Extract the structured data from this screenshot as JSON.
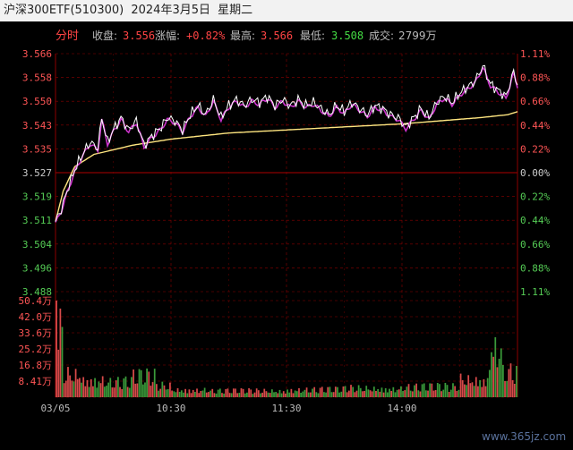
{
  "header": {
    "title": "沪深300ETF(510300)",
    "date": "2024年3月5日",
    "weekday": "星期二"
  },
  "chart_header": {
    "mode": "分时",
    "close_label": "收盘:",
    "close_value": "3.556",
    "change_label": "涨幅:",
    "change_value": "+0.82%",
    "high_label": "最高:",
    "high_value": "3.566",
    "low_label": "最低:",
    "low_value": "3.508",
    "volume_label": "成交:",
    "volume_value": "2799万"
  },
  "watermark": "www.365jz.com",
  "colors": {
    "background": "#000000",
    "grid": "#8b0000",
    "price_line": "#ffffff",
    "second_line": "#cc33cc",
    "avg_line": "#ffe680",
    "up": "#ff5555",
    "down": "#55cc55"
  },
  "chart_data": {
    "type": "line",
    "price_axis": {
      "range": [
        3.488,
        3.566
      ],
      "ticks": [
        "3.566",
        "3.558",
        "3.550",
        "3.543",
        "3.535",
        "3.527",
        "3.519",
        "3.511",
        "3.504",
        "3.496",
        "3.488"
      ],
      "reference": 3.527
    },
    "pct_axis": {
      "ticks": [
        "1.11%",
        "0.88%",
        "0.66%",
        "0.44%",
        "0.22%",
        "0.00%",
        "0.22%",
        "0.44%",
        "0.66%",
        "0.88%",
        "1.11%"
      ]
    },
    "volume_axis": {
      "range": [
        0,
        50.4
      ],
      "unit": "万",
      "ticks": [
        "50.4万",
        "42.0万",
        "33.6万",
        "25.2万",
        "16.8万",
        "8.41万"
      ]
    },
    "time_labels": [
      "03/05",
      "10:30",
      "11:30",
      "14:00"
    ],
    "price_anchors": [
      [
        0,
        3.511
      ],
      [
        3,
        3.515
      ],
      [
        6,
        3.521
      ],
      [
        10,
        3.528
      ],
      [
        14,
        3.533
      ],
      [
        18,
        3.537
      ],
      [
        22,
        3.535
      ],
      [
        24,
        3.545
      ],
      [
        27,
        3.537
      ],
      [
        30,
        3.541
      ],
      [
        34,
        3.545
      ],
      [
        38,
        3.541
      ],
      [
        42,
        3.544
      ],
      [
        46,
        3.536
      ],
      [
        50,
        3.539
      ],
      [
        55,
        3.542
      ],
      [
        58,
        3.545
      ],
      [
        62,
        3.544
      ],
      [
        66,
        3.541
      ],
      [
        70,
        3.546
      ],
      [
        74,
        3.549
      ],
      [
        78,
        3.546
      ],
      [
        82,
        3.551
      ],
      [
        86,
        3.545
      ],
      [
        90,
        3.549
      ],
      [
        94,
        3.551
      ],
      [
        98,
        3.549
      ],
      [
        102,
        3.551
      ],
      [
        106,
        3.55
      ],
      [
        110,
        3.552
      ],
      [
        114,
        3.549
      ],
      [
        118,
        3.551
      ],
      [
        122,
        3.549
      ],
      [
        126,
        3.551
      ],
      [
        130,
        3.549
      ],
      [
        134,
        3.55
      ],
      [
        138,
        3.548
      ],
      [
        142,
        3.546
      ],
      [
        146,
        3.549
      ],
      [
        150,
        3.547
      ],
      [
        154,
        3.55
      ],
      [
        158,
        3.548
      ],
      [
        162,
        3.546
      ],
      [
        166,
        3.549
      ],
      [
        170,
        3.548
      ],
      [
        174,
        3.546
      ],
      [
        178,
        3.545
      ],
      [
        182,
        3.542
      ],
      [
        186,
        3.545
      ],
      [
        190,
        3.548
      ],
      [
        194,
        3.545
      ],
      [
        198,
        3.55
      ],
      [
        202,
        3.552
      ],
      [
        206,
        3.55
      ],
      [
        210,
        3.553
      ],
      [
        214,
        3.555
      ],
      [
        218,
        3.557
      ],
      [
        222,
        3.562
      ],
      [
        226,
        3.556
      ],
      [
        230,
        3.554
      ],
      [
        234,
        3.552
      ],
      [
        238,
        3.56
      ],
      [
        240,
        3.556
      ]
    ],
    "avg_anchors": [
      [
        0,
        3.511
      ],
      [
        4,
        3.521
      ],
      [
        10,
        3.529
      ],
      [
        20,
        3.533
      ],
      [
        40,
        3.536
      ],
      [
        60,
        3.538
      ],
      [
        90,
        3.54
      ],
      [
        120,
        3.541
      ],
      [
        150,
        3.542
      ],
      [
        180,
        3.543
      ],
      [
        200,
        3.544
      ],
      [
        220,
        3.545
      ],
      [
        235,
        3.546
      ],
      [
        240,
        3.547
      ]
    ],
    "volume_segments": [
      {
        "start": 0,
        "end": 4,
        "level": 50.4
      },
      {
        "start": 4,
        "end": 14,
        "level": 18
      },
      {
        "start": 14,
        "end": 26,
        "level": 14
      },
      {
        "start": 26,
        "end": 40,
        "level": 12
      },
      {
        "start": 40,
        "end": 52,
        "level": 16
      },
      {
        "start": 52,
        "end": 60,
        "level": 9
      },
      {
        "start": 60,
        "end": 80,
        "level": 6
      },
      {
        "start": 80,
        "end": 120,
        "level": 5
      },
      {
        "start": 120,
        "end": 150,
        "level": 6
      },
      {
        "start": 150,
        "end": 180,
        "level": 7
      },
      {
        "start": 180,
        "end": 210,
        "level": 8
      },
      {
        "start": 210,
        "end": 225,
        "level": 14
      },
      {
        "start": 225,
        "end": 232,
        "level": 40
      },
      {
        "start": 232,
        "end": 240,
        "level": 20
      }
    ]
  }
}
